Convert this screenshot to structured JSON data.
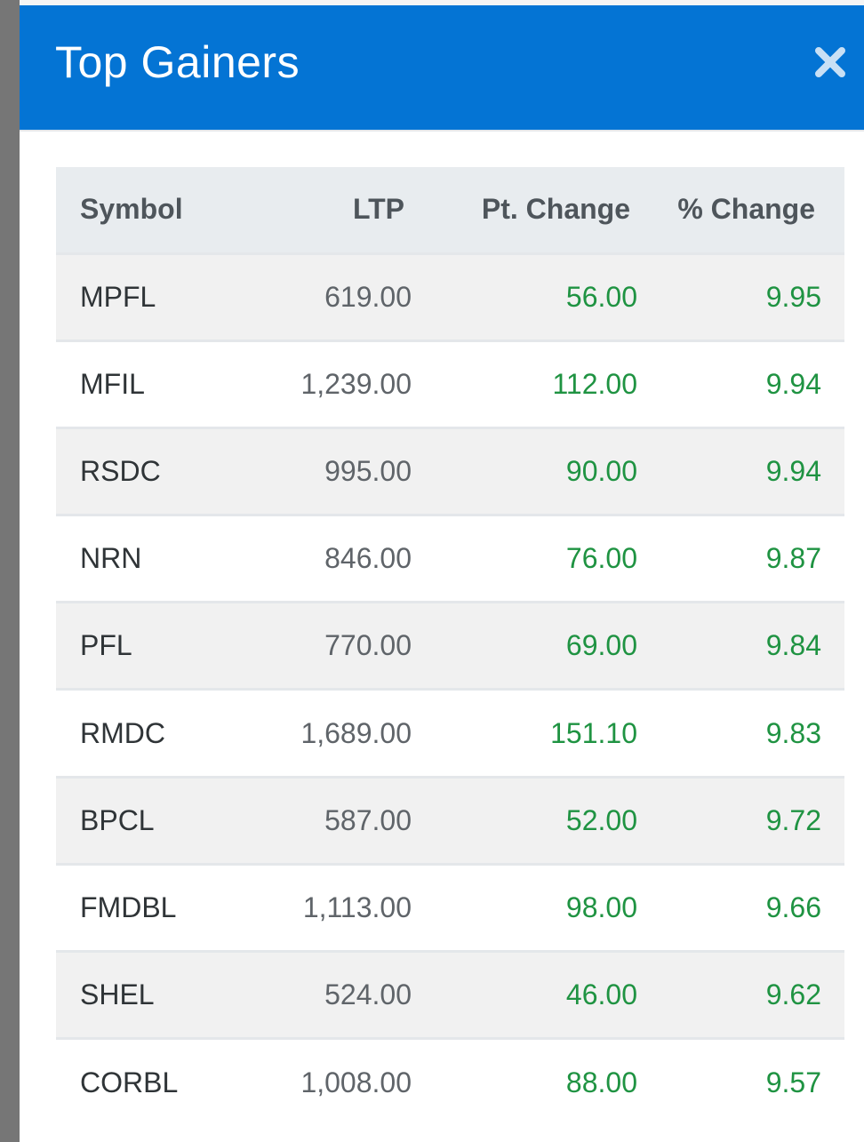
{
  "header": {
    "title": "Top Gainers",
    "close_icon": "close-icon"
  },
  "colors": {
    "header_bg": "#0474d4",
    "header_text": "#ffffff",
    "positive": "#1f9342",
    "row_alt": "#f1f1f1",
    "table_head_bg": "#e8ecef"
  },
  "table": {
    "columns": [
      "Symbol",
      "LTP",
      "Pt. Change",
      "% Change"
    ],
    "rows": [
      {
        "symbol": "MPFL",
        "ltp": "619.00",
        "pt_change": "56.00",
        "pct_change": "9.95"
      },
      {
        "symbol": "MFIL",
        "ltp": "1,239.00",
        "pt_change": "112.00",
        "pct_change": "9.94"
      },
      {
        "symbol": "RSDC",
        "ltp": "995.00",
        "pt_change": "90.00",
        "pct_change": "9.94"
      },
      {
        "symbol": "NRN",
        "ltp": "846.00",
        "pt_change": "76.00",
        "pct_change": "9.87"
      },
      {
        "symbol": "PFL",
        "ltp": "770.00",
        "pt_change": "69.00",
        "pct_change": "9.84"
      },
      {
        "symbol": "RMDC",
        "ltp": "1,689.00",
        "pt_change": "151.10",
        "pct_change": "9.83"
      },
      {
        "symbol": "BPCL",
        "ltp": "587.00",
        "pt_change": "52.00",
        "pct_change": "9.72"
      },
      {
        "symbol": "FMDBL",
        "ltp": "1,113.00",
        "pt_change": "98.00",
        "pct_change": "9.66"
      },
      {
        "symbol": "SHEL",
        "ltp": "524.00",
        "pt_change": "46.00",
        "pct_change": "9.62"
      },
      {
        "symbol": "CORBL",
        "ltp": "1,008.00",
        "pt_change": "88.00",
        "pct_change": "9.57"
      }
    ]
  }
}
